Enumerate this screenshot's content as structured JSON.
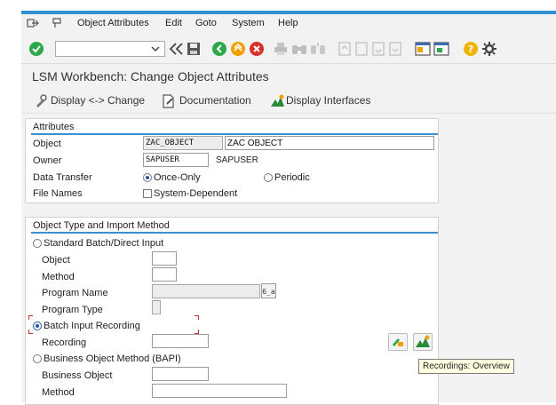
{
  "menu": {
    "items": [
      "Object Attributes",
      "Edit",
      "Goto",
      "System",
      "Help"
    ]
  },
  "toolbar": {
    "command_field_value": "",
    "icons": [
      "check-icon",
      "command-dropdown-icon",
      "back-double-icon",
      "save-icon",
      "back-icon",
      "exit-icon",
      "cancel-icon",
      "print-icon",
      "find-icon",
      "find-next-icon",
      "first-page-icon",
      "prev-page-icon",
      "next-page-icon",
      "last-page-icon",
      "new-session-icon",
      "shortcut-icon",
      "help-icon",
      "settings-icon"
    ]
  },
  "title": "LSM Workbench: Change Object Attributes",
  "app_toolbar": {
    "display_change": "Display <-> Change",
    "documentation": "Documentation",
    "display_interfaces": "Display Interfaces"
  },
  "attributes": {
    "title": "Attributes",
    "object_label": "Object",
    "object_value": "ZAC_OBJECT",
    "object_desc": "ZAC OBJECT",
    "owner_label": "Owner",
    "owner_value": "SAPUSER",
    "owner_desc": "SAPUSER",
    "data_transfer_label": "Data Transfer",
    "once_only_label": "Once-Only",
    "periodic_label": "Periodic",
    "file_names_label": "File Names",
    "system_dependent_label": "System-Dependent"
  },
  "import_method": {
    "title": "Object Type and Import Method",
    "standard_batch_label": "Standard Batch/Direct Input",
    "object_label": "Object",
    "method_label": "Method",
    "program_name_label": "Program Name",
    "program_type_label": "Program Type",
    "batch_input_recording_label": "Batch Input Recording",
    "recording_label": "Recording",
    "bapi_label": "Business Object Method  (BAPI)",
    "business_object_label": "Business Object",
    "method2_label": "Method"
  },
  "tooltip": "Recordings: Overview",
  "colors": {
    "accent_blue": "#2f93d3",
    "ok_green": "#2aa84a",
    "cancel_red": "#d9322b",
    "help_yellow": "#f0b400"
  }
}
